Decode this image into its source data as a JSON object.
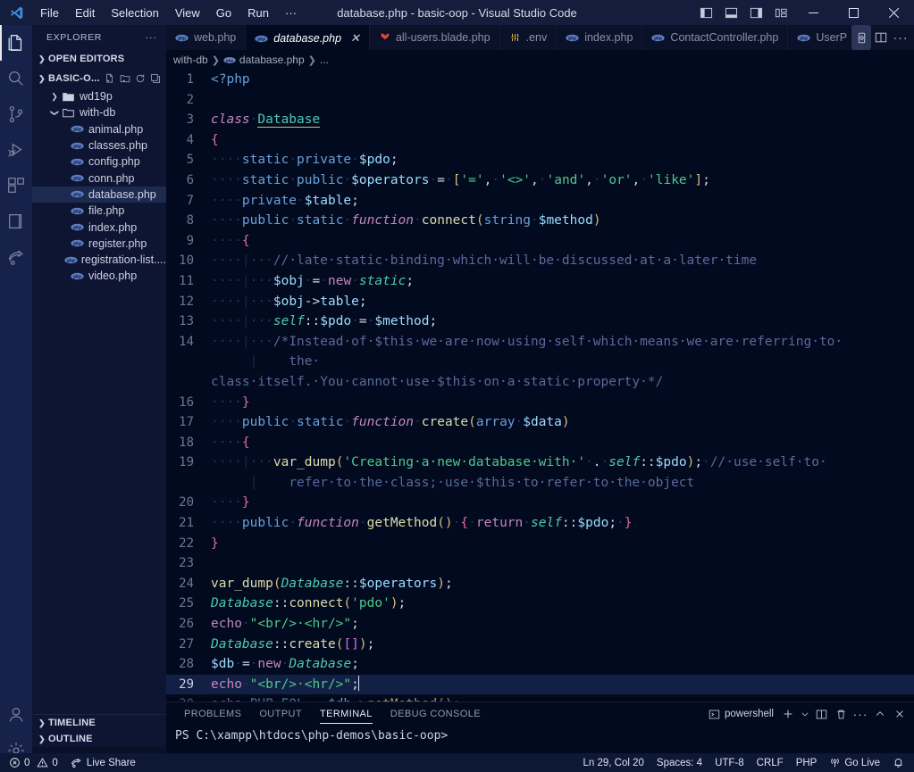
{
  "titlebar": {
    "menus": [
      "File",
      "Edit",
      "Selection",
      "View",
      "Go",
      "Run",
      "···"
    ],
    "title": "database.php - basic-oop - Visual Studio Code",
    "layout_icons": [
      "toggle-primary-sidebar-icon",
      "toggle-panel-icon",
      "toggle-secondary-sidebar-icon",
      "customize-layout-icon"
    ],
    "window_buttons": [
      "minimize",
      "maximize",
      "close"
    ]
  },
  "activitybar": {
    "items": [
      {
        "name": "explorer",
        "active": true
      },
      {
        "name": "search",
        "active": false
      },
      {
        "name": "source-control",
        "active": false
      },
      {
        "name": "run-and-debug",
        "active": false
      },
      {
        "name": "extensions",
        "active": false
      },
      {
        "name": "book",
        "active": false
      },
      {
        "name": "live-share",
        "active": false
      }
    ],
    "bottom": [
      {
        "name": "accounts"
      },
      {
        "name": "settings"
      }
    ]
  },
  "sidebar": {
    "header": "EXPLORER",
    "header_more": "···",
    "open_editors": "OPEN EDITORS",
    "project": "BASIC-O...",
    "project_actions": [
      "new-file-icon",
      "new-folder-icon",
      "refresh-icon",
      "collapse-all-icon"
    ],
    "tree": [
      {
        "label": "wd19p",
        "type": "folder",
        "depth": 1,
        "expanded": false,
        "selected": false
      },
      {
        "label": "with-db",
        "type": "folder",
        "depth": 1,
        "expanded": true,
        "selected": false
      },
      {
        "label": "animal.php",
        "type": "php",
        "depth": 2,
        "selected": false
      },
      {
        "label": "classes.php",
        "type": "php",
        "depth": 2,
        "selected": false
      },
      {
        "label": "config.php",
        "type": "php",
        "depth": 2,
        "selected": false
      },
      {
        "label": "conn.php",
        "type": "php",
        "depth": 2,
        "selected": false
      },
      {
        "label": "database.php",
        "type": "php",
        "depth": 2,
        "selected": true
      },
      {
        "label": "file.php",
        "type": "php",
        "depth": 2,
        "selected": false
      },
      {
        "label": "index.php",
        "type": "php",
        "depth": 2,
        "selected": false
      },
      {
        "label": "register.php",
        "type": "php",
        "depth": 2,
        "selected": false
      },
      {
        "label": "registration-list....",
        "type": "php",
        "depth": 2,
        "selected": false
      },
      {
        "label": "video.php",
        "type": "php",
        "depth": 2,
        "selected": false
      }
    ],
    "bottom_sections": [
      "TIMELINE",
      "OUTLINE"
    ]
  },
  "editor": {
    "tabs": [
      {
        "label": "web.php",
        "icon": "php-icon",
        "active": false,
        "close": false
      },
      {
        "label": "database.php",
        "icon": "php-icon",
        "active": true,
        "close": true
      },
      {
        "label": "all-users.blade.php",
        "icon": "blade-icon",
        "active": false,
        "close": false
      },
      {
        "label": ".env",
        "icon": "env-icon",
        "active": false,
        "close": false
      },
      {
        "label": "index.php",
        "icon": "php-icon",
        "active": false,
        "close": false
      },
      {
        "label": "ContactController.php",
        "icon": "php-icon",
        "active": false,
        "close": false
      },
      {
        "label": "UserP",
        "icon": "php-icon",
        "active": false,
        "close": false
      }
    ],
    "tab_actions": [
      "run-php-icon",
      "split-editor-icon",
      "more-actions-icon"
    ],
    "breadcrumb": [
      "with-db",
      "database.php",
      "..."
    ],
    "cursor_line": 29
  },
  "panel": {
    "tabs": [
      "PROBLEMS",
      "OUTPUT",
      "TERMINAL",
      "DEBUG CONSOLE"
    ],
    "active_tab": "TERMINAL",
    "shell": "powershell",
    "actions": [
      "new-terminal-icon",
      "terminal-dropdown-icon",
      "split-terminal-icon",
      "kill-terminal-icon",
      "more-icon",
      "maximize-panel-icon",
      "close-panel-icon"
    ],
    "terminal_line": "PS C:\\xampp\\htdocs\\php-demos\\basic-oop>"
  },
  "statusbar": {
    "errors": "0",
    "warnings": "0",
    "live_share": "Live Share",
    "position": "Ln 29, Col 20",
    "spaces": "Spaces: 4",
    "encoding": "UTF-8",
    "eol": "CRLF",
    "language": "PHP",
    "go_live": "Go Live",
    "bell": "notifications-icon"
  },
  "code": {
    "lines": [
      {
        "n": 1,
        "html": "<span class=\"mod\">&lt;?php</span>"
      },
      {
        "n": 2,
        "html": ""
      },
      {
        "n": 3,
        "html": "<span class=\"kwi\">class</span><span class=\"ws\">·</span><span class=\"clsu\">Database</span>"
      },
      {
        "n": 4,
        "html": "<span class=\"brc\">{</span>"
      },
      {
        "n": 5,
        "html": "<span class=\"ws\">····</span><span class=\"mod\">static</span><span class=\"ws\">·</span><span class=\"mod\">private</span><span class=\"ws\">·</span><span class=\"var\">$pdo</span><span class=\"pun\">;</span>"
      },
      {
        "n": 6,
        "html": "<span class=\"ws\">····</span><span class=\"mod\">static</span><span class=\"ws\">·</span><span class=\"mod\">public</span><span class=\"ws\">·</span><span class=\"var\">$operators</span><span class=\"ws\">·</span><span class=\"op\">=</span><span class=\"ws\">·</span><span class=\"par\">[</span><span class=\"str\">'='</span><span class=\"pun\">,</span><span class=\"ws\">·</span><span class=\"str\">'&lt;&gt;'</span><span class=\"pun\">,</span><span class=\"ws\">·</span><span class=\"str\">'and'</span><span class=\"pun\">,</span><span class=\"ws\">·</span><span class=\"str\">'or'</span><span class=\"pun\">,</span><span class=\"ws\">·</span><span class=\"str\">'like'</span><span class=\"par\">]</span><span class=\"pun\">;</span>"
      },
      {
        "n": 7,
        "html": "<span class=\"ws\">····</span><span class=\"mod\">private</span><span class=\"ws\">·</span><span class=\"var\">$table</span><span class=\"pun\">;</span>"
      },
      {
        "n": 8,
        "html": "<span class=\"ws\">····</span><span class=\"mod\">public</span><span class=\"ws\">·</span><span class=\"mod\">static</span><span class=\"ws\">·</span><span class=\"kwi\">function</span><span class=\"ws\">·</span><span class=\"fn\">connect</span><span class=\"par\">(</span><span class=\"mod\">string</span><span class=\"ws\">·</span><span class=\"var\">$method</span><span class=\"par\">)</span>"
      },
      {
        "n": 9,
        "html": "<span class=\"ws\">····</span><span class=\"brc\">{</span>"
      },
      {
        "n": 10,
        "html": "<span class=\"ws\">····</span><span class=\"guide\">|</span><span class=\"ws\">···</span><span class=\"cmt\">//·late·static·binding·which·will·be·discussed·at·a·later·time</span>"
      },
      {
        "n": 11,
        "html": "<span class=\"ws\">····</span><span class=\"guide\">|</span><span class=\"ws\">···</span><span class=\"var\">$obj</span><span class=\"ws\">·</span><span class=\"op\">=</span><span class=\"ws\">·</span><span class=\"kw\">new</span><span class=\"ws\">·</span><span class=\"cls\">static</span><span class=\"pun\">;</span>"
      },
      {
        "n": 12,
        "html": "<span class=\"ws\">····</span><span class=\"guide\">|</span><span class=\"ws\">···</span><span class=\"var\">$obj</span><span class=\"op\">-&gt;</span><span class=\"var\">table</span><span class=\"pun\">;</span>"
      },
      {
        "n": 13,
        "html": "<span class=\"ws\">····</span><span class=\"guide\">|</span><span class=\"ws\">···</span><span class=\"cls\">self</span><span class=\"pun\">::</span><span class=\"var\">$pdo</span><span class=\"ws\">·</span><span class=\"op\">=</span><span class=\"ws\">·</span><span class=\"var\">$method</span><span class=\"pun\">;</span>"
      },
      {
        "n": 14,
        "html": "<span class=\"ws\">····</span><span class=\"guide\">|</span><span class=\"ws\">···</span><span class=\"cmt\">/*Instead·of·$this·we·are·now·using·self·which·means·we·are·referring·to·</span>",
        "wrap": "<span class=\"ws\">     </span><span class=\"guide\">|</span><span class=\"ws\"> </span><span class=\"cmt\">   the·</span>"
      },
      {
        "n": 15,
        "html": "<span class=\"cmt\">class·itself.·You·cannot·use·$this·on·a·static·property·*/</span>",
        "nogut": true
      },
      {
        "n": 16,
        "html": "<span class=\"ws\">····</span><span class=\"brc\">}</span>"
      },
      {
        "n": 17,
        "html": "<span class=\"ws\">····</span><span class=\"mod\">public</span><span class=\"ws\">·</span><span class=\"mod\">static</span><span class=\"ws\">·</span><span class=\"kwi\">function</span><span class=\"ws\">·</span><span class=\"fn\">create</span><span class=\"par\">(</span><span class=\"mod\">array</span><span class=\"ws\">·</span><span class=\"var\">$data</span><span class=\"par\">)</span>"
      },
      {
        "n": 18,
        "html": "<span class=\"ws\">····</span><span class=\"brc\">{</span>"
      },
      {
        "n": 19,
        "html": "<span class=\"ws\">····</span><span class=\"guide\">|</span><span class=\"ws\">···</span><span class=\"fn\">var_dump</span><span class=\"par\">(</span><span class=\"str\">'Creating·a·new·database·with·'</span><span class=\"ws\">·</span><span class=\"op\">.</span><span class=\"ws\">·</span><span class=\"cls\">self</span><span class=\"pun\">::</span><span class=\"var\">$pdo</span><span class=\"par\">)</span><span class=\"pun\">;</span><span class=\"ws\">·</span><span class=\"cmt\">//·use·self·to·</span>",
        "wrap": "<span class=\"ws\">     </span><span class=\"guide\">|</span><span class=\"ws\"> </span><span class=\"cmt\">   refer·to·the·class;·use·$this·to·refer·to·the·object</span>"
      },
      {
        "n": 20,
        "html": "<span class=\"ws\">····</span><span class=\"brc\">}</span>"
      },
      {
        "n": 21,
        "html": "<span class=\"ws\">····</span><span class=\"mod\">public</span><span class=\"ws\">·</span><span class=\"kwi\">function</span><span class=\"ws\">·</span><span class=\"fn\">getMethod</span><span class=\"par\">()</span><span class=\"ws\">·</span><span class=\"brc\">{</span><span class=\"ws\">·</span><span class=\"kw\">return</span><span class=\"ws\">·</span><span class=\"cls\">self</span><span class=\"pun\">::</span><span class=\"var\">$pdo</span><span class=\"pun\">;</span><span class=\"ws\">·</span><span class=\"brc\">}</span>"
      },
      {
        "n": 22,
        "html": "<span class=\"brc\">}</span>"
      },
      {
        "n": 23,
        "html": ""
      },
      {
        "n": 24,
        "html": "<span class=\"fn\">var_dump</span><span class=\"par\">(</span><span class=\"cls\">Database</span><span class=\"pun\">::</span><span class=\"var\">$operators</span><span class=\"par\">)</span><span class=\"pun\">;</span>"
      },
      {
        "n": 25,
        "html": "<span class=\"cls\">Database</span><span class=\"pun\">::</span><span class=\"fn\">connect</span><span class=\"par\">(</span><span class=\"str\">'pdo'</span><span class=\"par\">)</span><span class=\"pun\">;</span>"
      },
      {
        "n": 26,
        "html": "<span class=\"kw\">echo</span><span class=\"ws\">·</span><span class=\"str\">\"&lt;br/&gt;·&lt;hr/&gt;\"</span><span class=\"pun\">;</span>"
      },
      {
        "n": 27,
        "html": "<span class=\"cls\">Database</span><span class=\"pun\">::</span><span class=\"fn\">create</span><span class=\"par\">(</span><span class=\"par2\">[]</span><span class=\"par\">)</span><span class=\"pun\">;</span>"
      },
      {
        "n": 28,
        "html": "<span class=\"var\">$db</span><span class=\"ws\">·</span><span class=\"op\">=</span><span class=\"ws\">·</span><span class=\"kw\">new</span><span class=\"ws\">·</span><span class=\"cls\">Database</span><span class=\"pun\">;</span>"
      },
      {
        "n": 29,
        "html": "<span class=\"kw\">echo</span><span class=\"ws\">·</span><span class=\"str\">\"&lt;br/&gt;·&lt;hr/&gt;\"</span><span class=\"pun\">;</span><span class=\"cursor\"></span>",
        "highlight": true
      },
      {
        "n": 30,
        "html": "<span class=\"kw\">echo</span><span class=\"ws\">·</span><span class=\"mod\">PHP_EOL</span><span class=\"ws\">·</span><span class=\"op\">.</span><span class=\"ws\">·</span><span class=\"var\">$db</span><span class=\"op\">-&gt;</span><span class=\"fn\">getMethod</span><span class=\"par\">()</span><span class=\"pun\">;</span>",
        "clipped": true
      }
    ]
  }
}
